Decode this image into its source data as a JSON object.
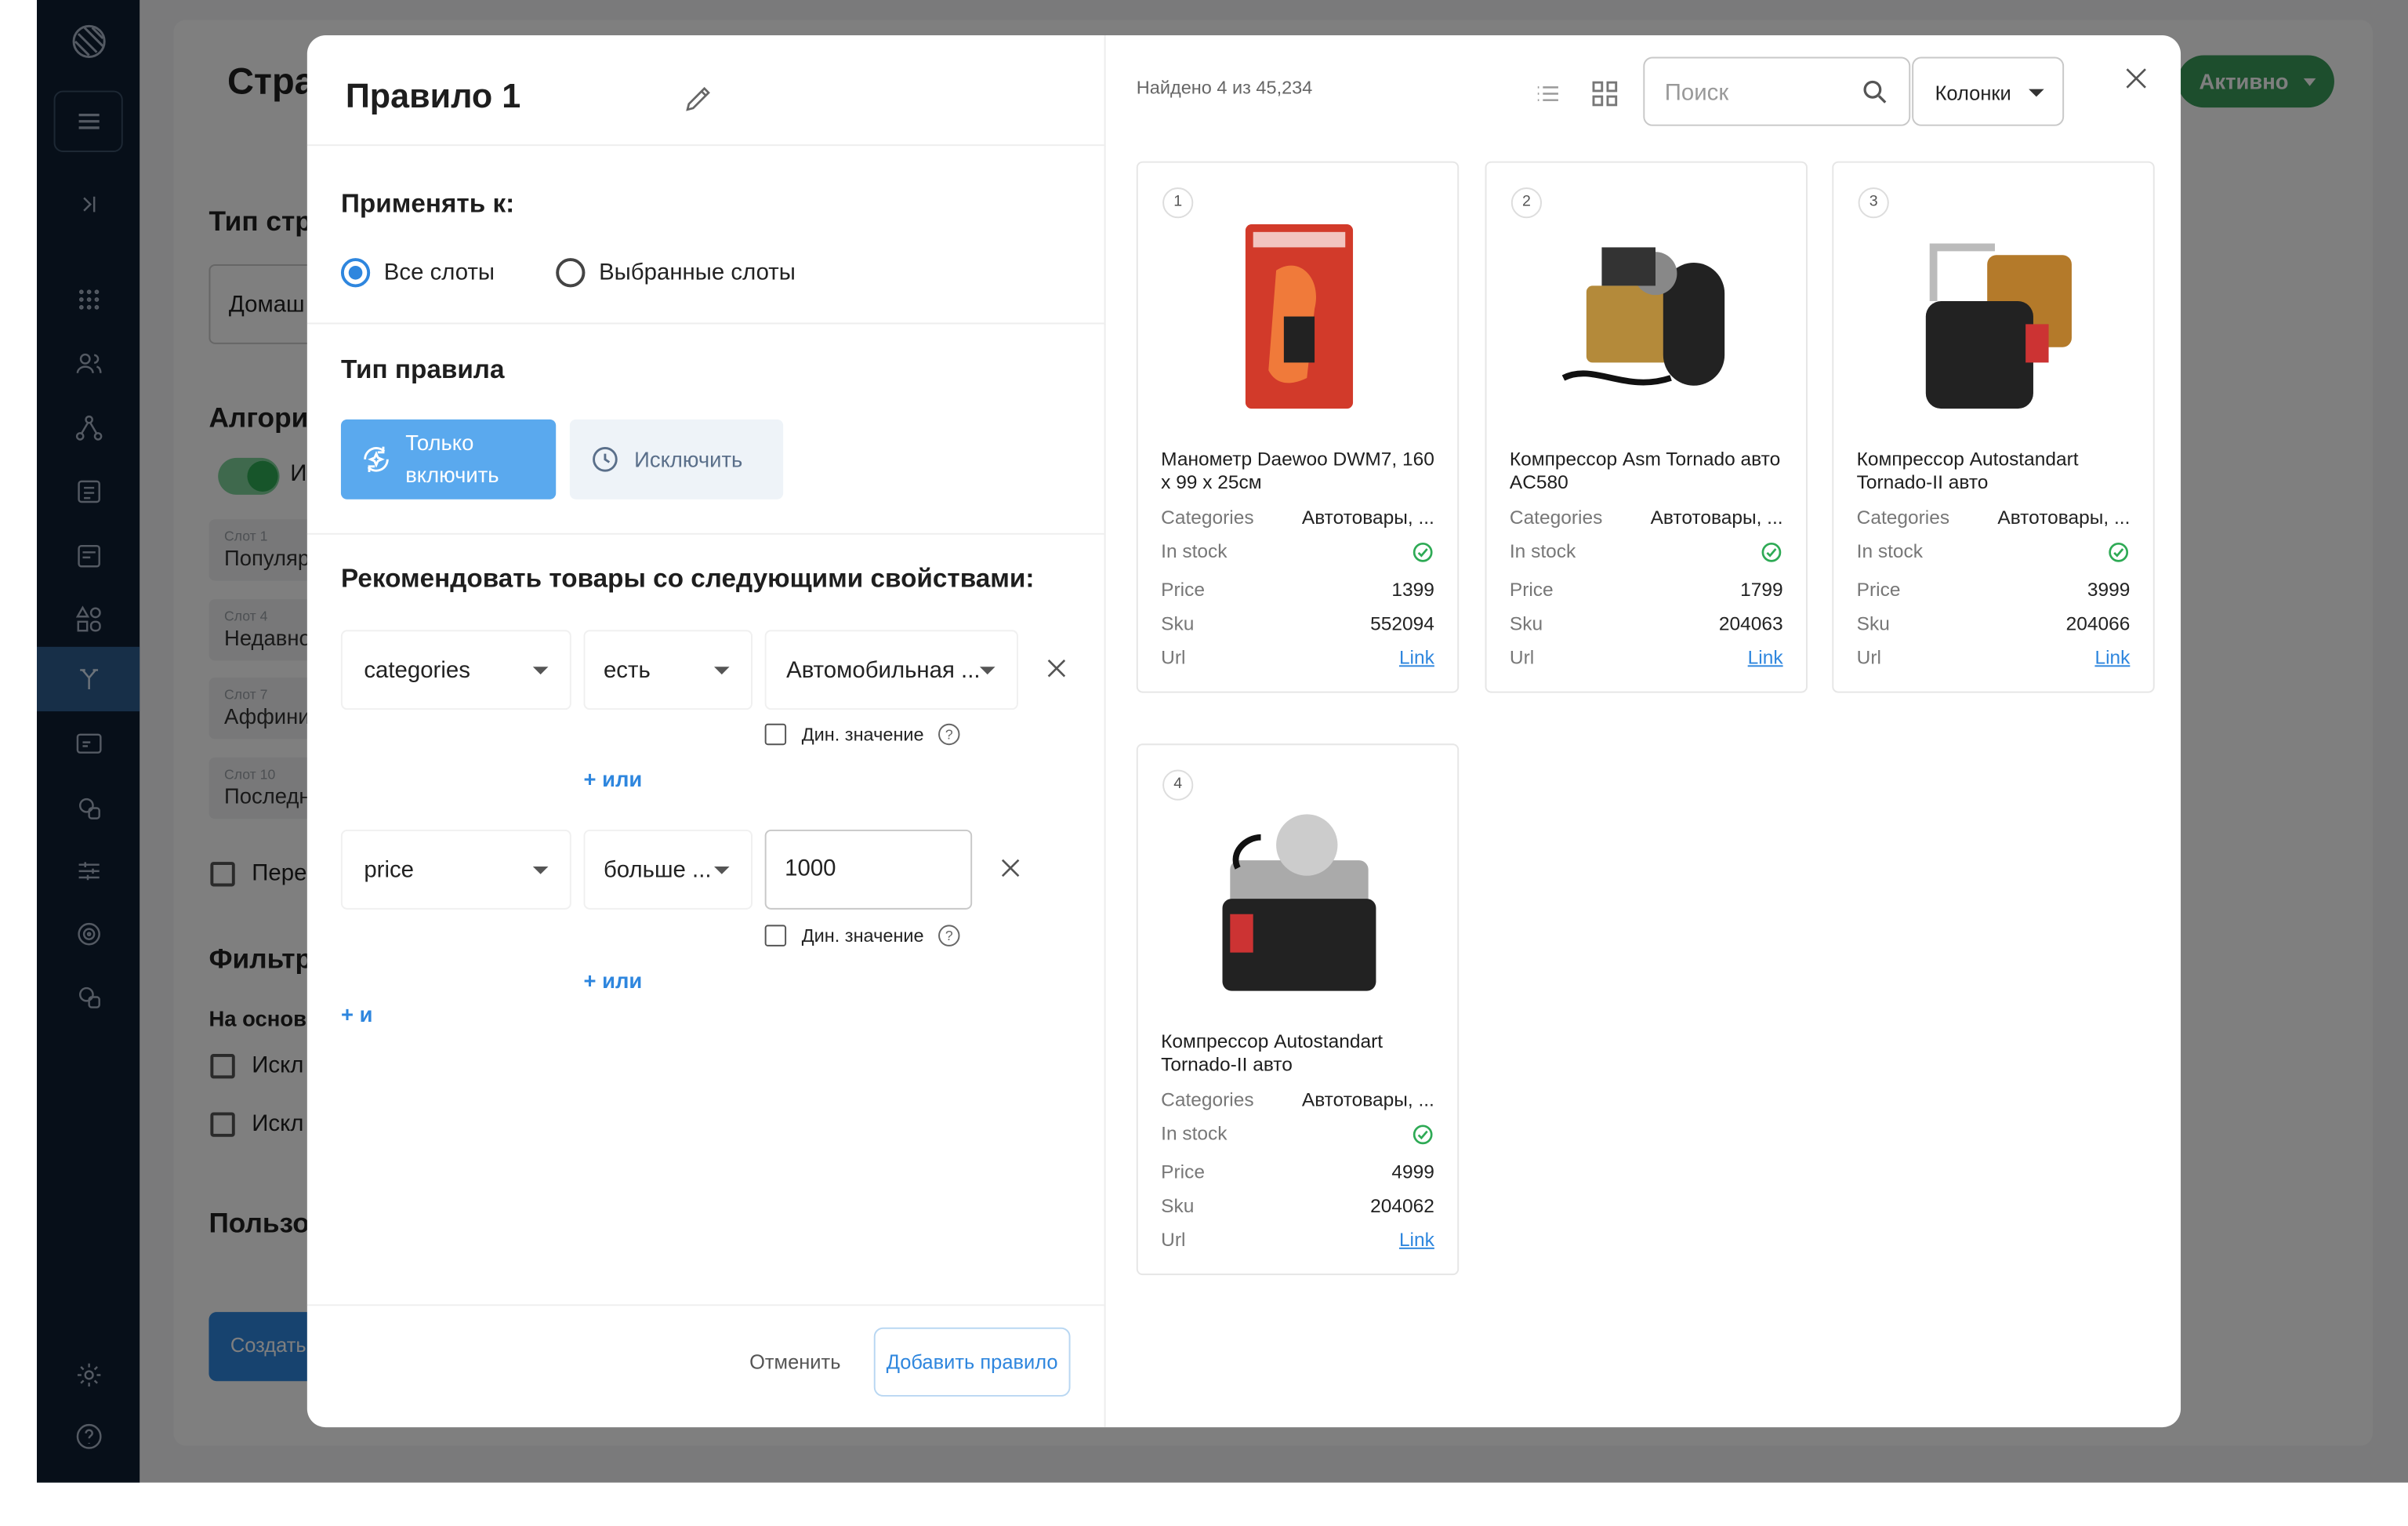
{
  "background": {
    "page_title": "Стра",
    "section_type": "Тип стр",
    "select_value": "Домаш",
    "section_algo": "Алгори",
    "toggle_label": "И",
    "slots": [
      {
        "label": "Слот 1",
        "value": "Популяр"
      },
      {
        "label": "Слот 4",
        "value": "Недавно"
      },
      {
        "label": "Слот 7",
        "value": "Аффини"
      },
      {
        "label": "Слот 10",
        "value": "Последн"
      }
    ],
    "check_label_1": "Пере",
    "section_filter": "Фильтр",
    "based_on": "На основ",
    "excl_1": "Искл",
    "excl_2": "Искл",
    "section_user": "Пользо",
    "create_btn": "Создать",
    "active_btn": "Активно"
  },
  "modal": {
    "title": "Правило 1",
    "apply_to": "Применять к:",
    "radio_all": "Все слоты",
    "radio_selected": "Выбранные слоты",
    "rule_type": "Тип правила",
    "btn_include_only": "Только включить",
    "btn_exclude": "Исключить",
    "recommend_heading": "Рекомендовать товары со следующими свойствами:",
    "conditions": [
      {
        "field": "categories",
        "operator": "есть",
        "value": "Автомобильная ...",
        "dyn_label": "Дин. значение",
        "or_label": "+ или"
      },
      {
        "field": "price",
        "operator": "больше ...",
        "value": "1000",
        "dyn_label": "Дин. значение",
        "or_label": "+ или"
      }
    ],
    "and_label": "+ и",
    "cancel": "Отменить",
    "add_rule": "Добавить правило"
  },
  "results": {
    "found": "Найдено 4 из 45,234",
    "search_placeholder": "Поиск",
    "columns_btn": "Колонки",
    "field_labels": {
      "categories": "Categories",
      "in_stock": "In stock",
      "price": "Price",
      "sku": "Sku",
      "url": "Url"
    },
    "products": [
      {
        "index": "1",
        "name": "Манометр Daewoo DWM7, 160 x 99 x 25см",
        "categories": "Автотовары, ...",
        "in_stock": true,
        "price": "1399",
        "sku": "552094",
        "url": "Link"
      },
      {
        "index": "2",
        "name": "Компрессор Asm Tornado авто AC580",
        "categories": "Автотовары, ...",
        "in_stock": true,
        "price": "1799",
        "sku": "204063",
        "url": "Link"
      },
      {
        "index": "3",
        "name": "Компрессор Autostandart Tornado-II авто",
        "categories": "Автотовары, ...",
        "in_stock": true,
        "price": "3999",
        "sku": "204066",
        "url": "Link"
      },
      {
        "index": "4",
        "name": "Компрессор Autostandart Tornado-II авто",
        "categories": "Автотовары, ...",
        "in_stock": true,
        "price": "4999",
        "sku": "204062",
        "url": "Link"
      }
    ]
  },
  "colors": {
    "accent": "#2e86de",
    "sidebar": "#0f1e33",
    "success": "#2eaa55",
    "active_green": "#3a9c5a"
  }
}
